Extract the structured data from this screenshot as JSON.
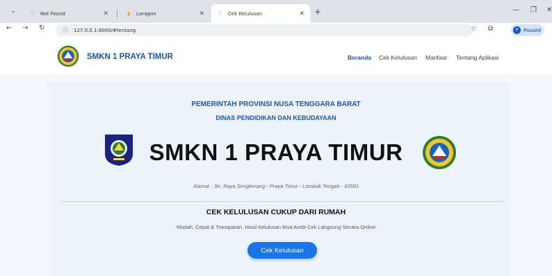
{
  "browser": {
    "tabs": [
      {
        "label": "Not Found",
        "active": false
      },
      {
        "label": "Laragon",
        "active": false
      },
      {
        "label": "Cek Kelulusan",
        "active": true
      }
    ],
    "new_tab": "+",
    "url": "127.0.0.1:8000/#tentang",
    "profile_label": "Paused",
    "icons": [
      "tab-search-icon",
      "back-icon",
      "forward-icon",
      "reload-icon",
      "site-info-icon",
      "bookmark-star-icon",
      "extensions-icon",
      "minimize-icon",
      "maximize-icon",
      "close-icon"
    ]
  },
  "site": {
    "brand": "SMKN 1 PRAYA TIMUR",
    "nav": [
      {
        "label": "Beranda",
        "active": true
      },
      {
        "label": "Cek Kelulusan",
        "active": false
      },
      {
        "label": "Manfaat",
        "active": false
      },
      {
        "label": "Tentang Aplikasi",
        "active": false
      }
    ]
  },
  "hero": {
    "province": "PEMERINTAH PROVINSI NUSA TENGGARA BARAT",
    "dinas": "DINAS PENDIDIKAN DAN KEBUDAYAAN",
    "school_name": "SMKN 1 PRAYA TIMUR",
    "address": "Alamat : Jln. Raya Sengkerang - Praya Timur - Lombok Tengah - 83581",
    "cek_title": "CEK KELULUSAN CUKUP DARI RUMAH",
    "cek_desc": "Mudah, Cepat & Transparan. Hasil Kelulusan Bisa Anda Cek Langsung Secara Online",
    "cek_button": "Cek Kelulusan"
  },
  "colors": {
    "accent": "#1a56b8",
    "button": "#1a73e8",
    "hero_bg": "#eef3fa"
  }
}
